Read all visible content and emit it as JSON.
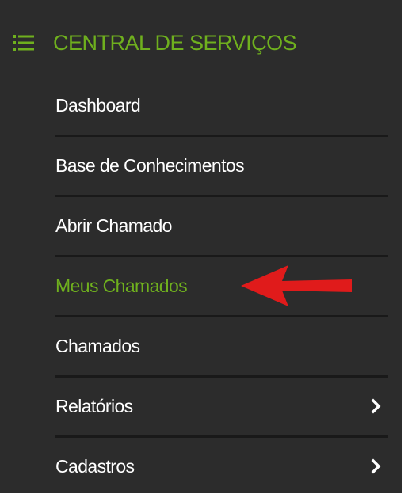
{
  "sidebar": {
    "section_title": "CENTRAL DE SERVIÇOS",
    "section_icon": "list-icon",
    "accent_color": "#6fb01e",
    "items": [
      {
        "label": "Dashboard",
        "has_submenu": false,
        "active": false
      },
      {
        "label": "Base de Conhecimentos",
        "has_submenu": false,
        "active": false
      },
      {
        "label": "Abrir Chamado",
        "has_submenu": false,
        "active": false
      },
      {
        "label": "Meus Chamados",
        "has_submenu": false,
        "active": true
      },
      {
        "label": "Chamados",
        "has_submenu": false,
        "active": false
      },
      {
        "label": "Relatórios",
        "has_submenu": true,
        "active": false
      },
      {
        "label": "Cadastros",
        "has_submenu": true,
        "active": false
      }
    ]
  },
  "annotation": {
    "icon": "red-arrow-icon",
    "color": "#e01b1b",
    "points_to": "Meus Chamados"
  }
}
